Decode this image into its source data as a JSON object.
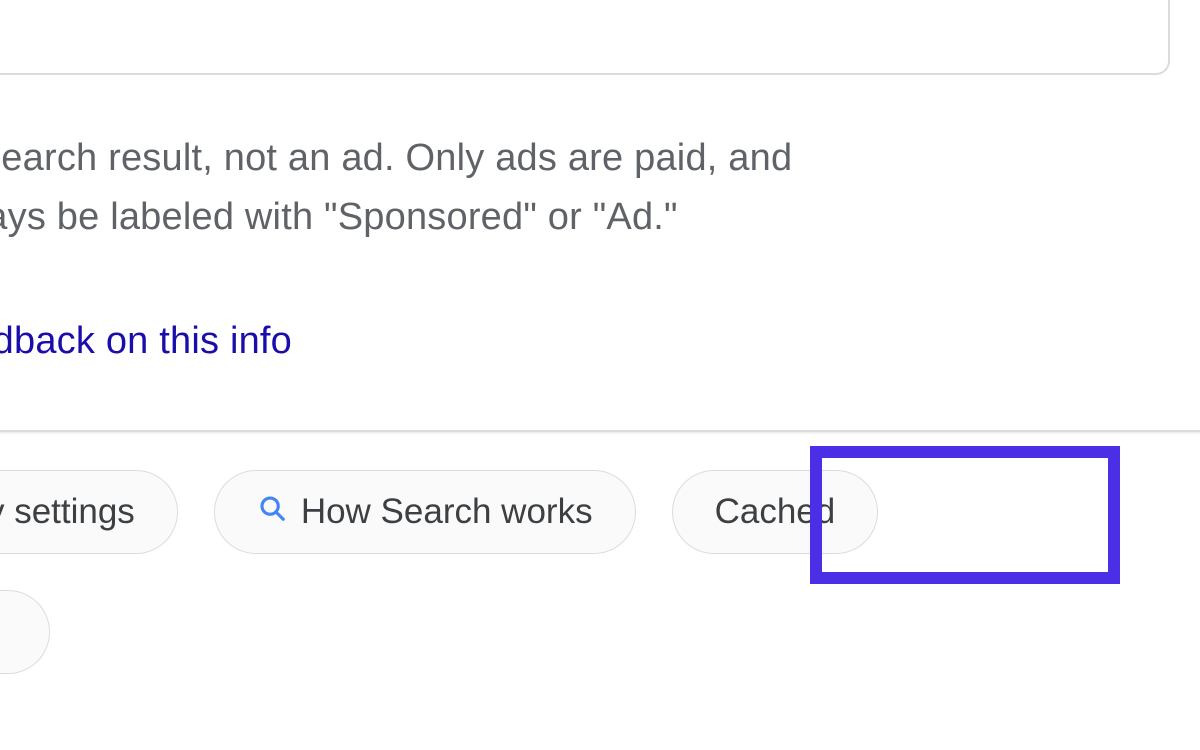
{
  "info": {
    "line1": "a search result, not an ad. Only ads are paid, and",
    "line2": "lways be labeled with \"Sponsored\" or \"Ad.\""
  },
  "feedback": {
    "label": "eedback on this info"
  },
  "chips": {
    "privacy": "acy settings",
    "how_search_works": "How Search works",
    "cached": "Cached"
  },
  "icons": {
    "search_color": "#4285f4"
  },
  "highlight": {
    "color": "#4b2fe6"
  }
}
